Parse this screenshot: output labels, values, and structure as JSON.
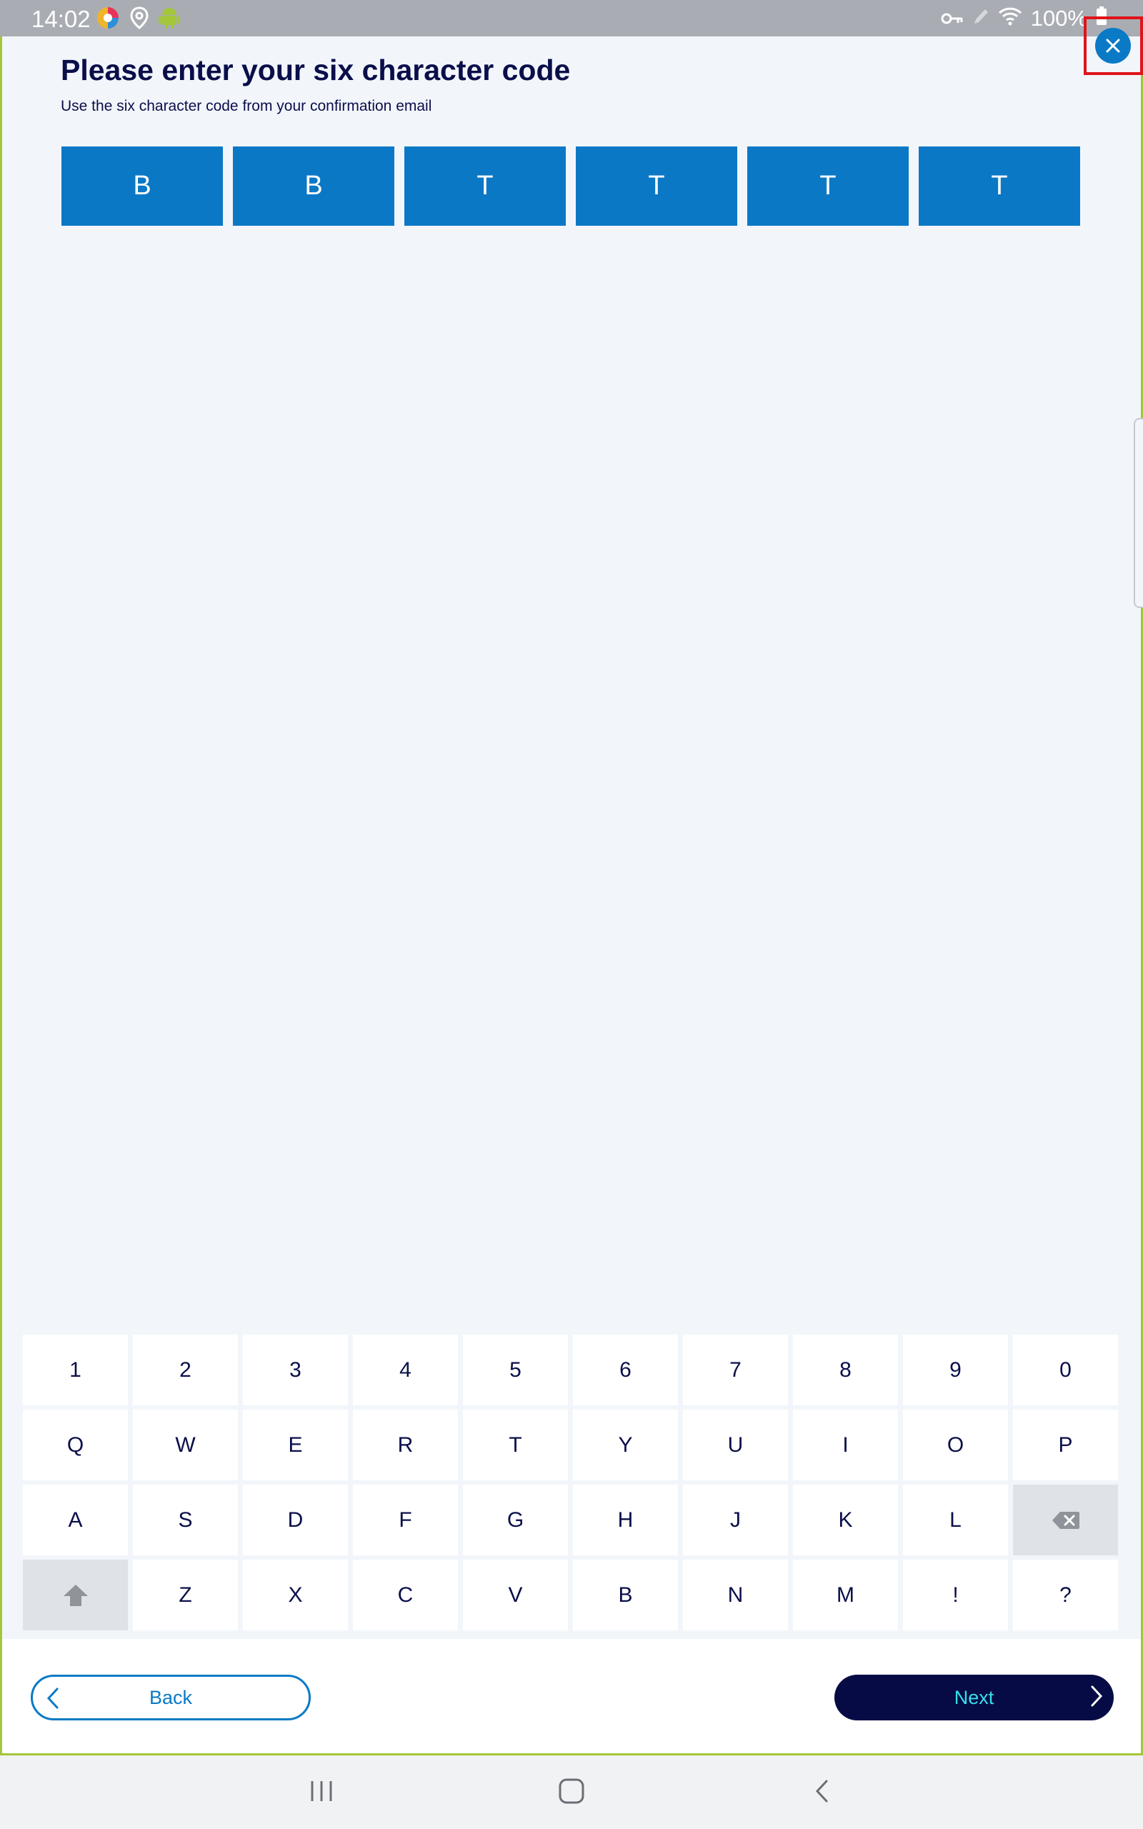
{
  "status_bar": {
    "time": "14:02",
    "battery": "100%"
  },
  "page": {
    "title": "Please enter your six character code",
    "subtitle": "Use the six character code from your confirmation email"
  },
  "code": [
    "B",
    "B",
    "T",
    "T",
    "T",
    "T"
  ],
  "keyboard": {
    "rows": [
      [
        "1",
        "2",
        "3",
        "4",
        "5",
        "6",
        "7",
        "8",
        "9",
        "0"
      ],
      [
        "Q",
        "W",
        "E",
        "R",
        "T",
        "Y",
        "U",
        "I",
        "O",
        "P"
      ],
      [
        "A",
        "S",
        "D",
        "F",
        "G",
        "H",
        "J",
        "K",
        "L"
      ],
      [
        "Z",
        "X",
        "C",
        "V",
        "B",
        "N",
        "M",
        "!",
        "?"
      ]
    ]
  },
  "footer": {
    "back_label": "Back",
    "next_label": "Next"
  },
  "colors": {
    "accent": "#0b78c6",
    "title": "#0a0f4a",
    "next_bg": "#070b45",
    "next_text": "#33e0ea",
    "highlight": "#e0131b"
  }
}
